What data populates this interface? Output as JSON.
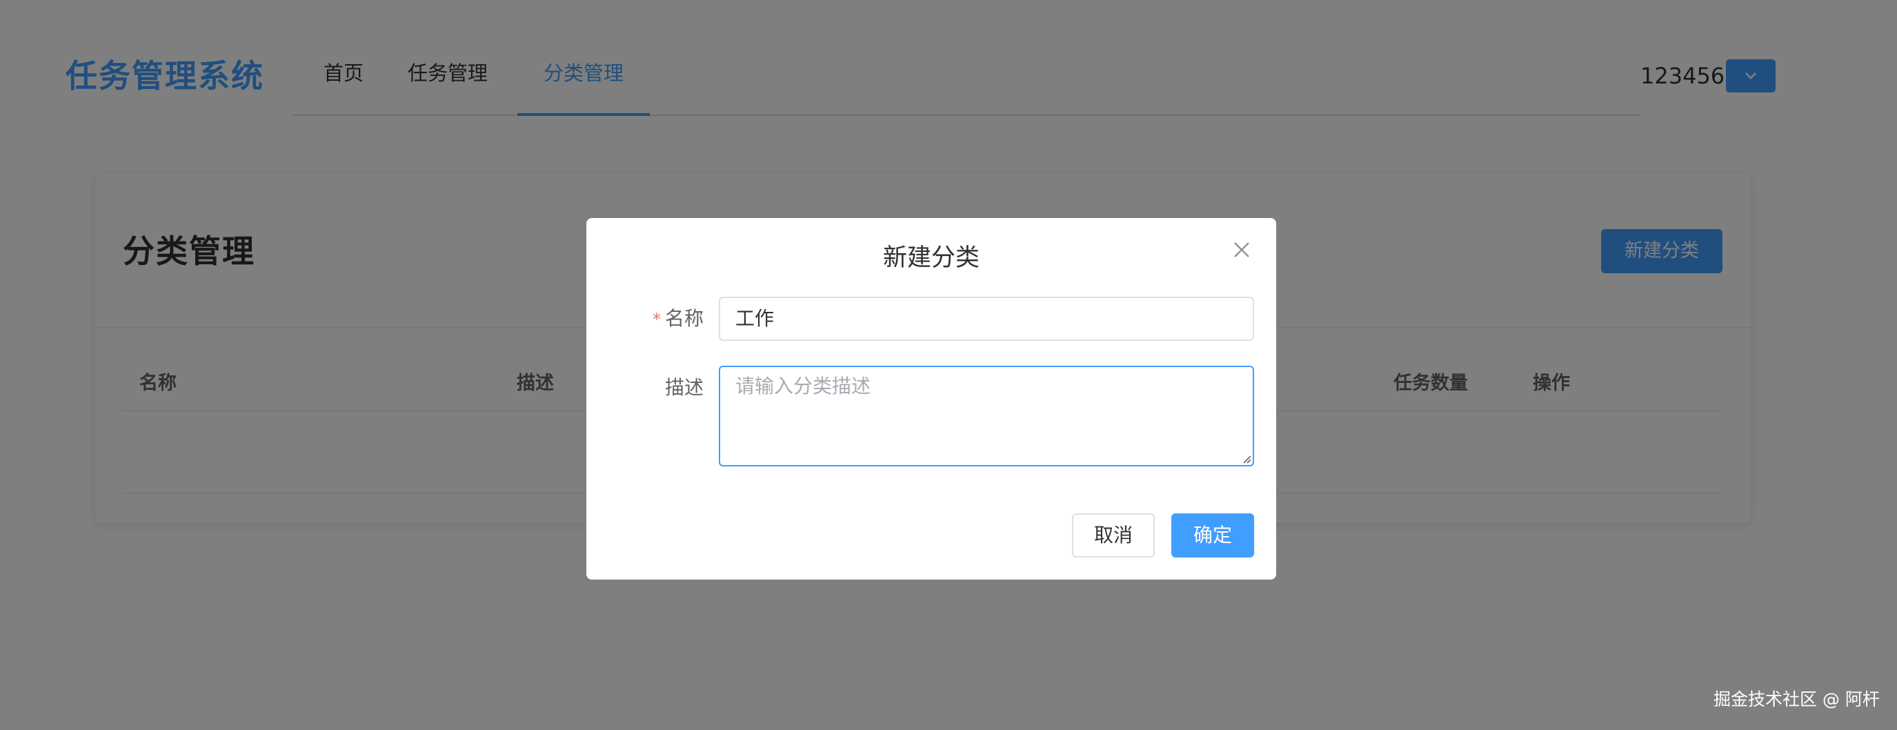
{
  "app": {
    "title": "任务管理系统"
  },
  "nav": {
    "items": [
      {
        "label": "首页",
        "active": false
      },
      {
        "label": "任务管理",
        "active": false
      },
      {
        "label": "分类管理",
        "active": true
      }
    ]
  },
  "user": {
    "name": "123456",
    "menu_icon": "chevron-down-icon"
  },
  "card": {
    "title": "分类管理",
    "new_button_label": "新建分类",
    "table": {
      "headers": [
        "名称",
        "描述",
        "任务数量",
        "操作"
      ],
      "rows": []
    }
  },
  "dialog": {
    "title": "新建分类",
    "close_icon": "close-icon",
    "name_label": "名称",
    "required_mark": "*",
    "name_value": "工作",
    "desc_label": "描述",
    "desc_placeholder": "请输入分类描述",
    "cancel_label": "取消",
    "ok_label": "确定"
  },
  "watermark": {
    "text": "掘金技术社区 @ 阿杆"
  },
  "colors": {
    "primary": "#409eff",
    "required": "#f56c6c",
    "text": "#303133",
    "overlay": "rgba(0,0,0,0.5)"
  }
}
